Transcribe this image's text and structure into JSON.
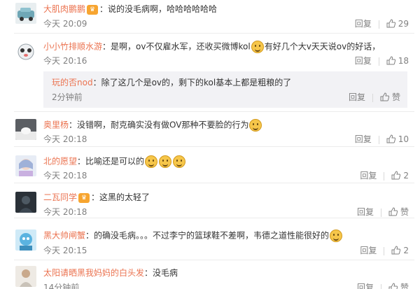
{
  "comments": [
    {
      "username": "大肌肉鹏鹏",
      "has_badge": true,
      "text": "说的没毛病啊，哈哈哈哈哈哈",
      "time": "今天 20:09",
      "reply_label": "回复",
      "likes": "29",
      "avatar_color": "#6fa7b6"
    },
    {
      "username": "小小竹排顺水游",
      "text_before_emoji": "是啊，ov不仅雇水军，还收买微博kol",
      "text_after_emoji": "有好几个大v天天说ov的好话，",
      "time": "今天 20:16",
      "reply_label": "回复",
      "likes": "18",
      "avatar_color": "#9aa4ab",
      "sub_reply": {
        "username": "玩的否nod",
        "text": "除了这几个是ov的，剩下的kol基本上都是粗粮的了",
        "time": "2分钟前",
        "reply_label": "回复",
        "likes_label": "赞"
      }
    },
    {
      "username": "奥里杨",
      "text": "没错啊，耐克确实没有做OV那种不要脸的行为",
      "time": "今天 20:18",
      "reply_label": "回复",
      "likes": "10",
      "avatar_color": "#5b5e63"
    },
    {
      "username": "北的愿望",
      "text": "比喻还是可以的",
      "time": "今天 20:18",
      "reply_label": "回复",
      "likes": "2",
      "avatar_color": "#9fb1d8"
    },
    {
      "username": "二瓦同学",
      "has_badge": true,
      "text": "这黑的太轻了",
      "time": "今天 20:18",
      "reply_label": "回复",
      "likes_label": "赞",
      "avatar_color": "#2a3138"
    },
    {
      "username": "黑大帅闸蟹",
      "text": "的确没毛病。。。不过李宁的篮球鞋不差啊，韦德之道性能很好的",
      "time": "今天 20:15",
      "reply_label": "回复",
      "likes": "2",
      "avatar_color": "#5ab3e0"
    },
    {
      "username": "太阳请晒黑我妈妈的白头发",
      "text": "没毛病",
      "time": "14分钟前",
      "reply_label": "回复",
      "likes_label": "赞",
      "avatar_color": "#c9c2b8"
    }
  ],
  "colors": {
    "username": "#eb7350",
    "text": "#333333",
    "meta": "#808080"
  }
}
